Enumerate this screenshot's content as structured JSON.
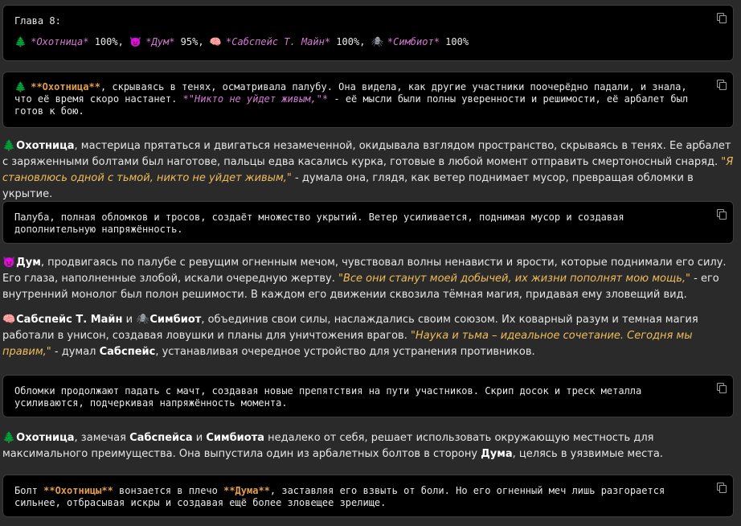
{
  "block1": {
    "line1": "Глава 8:",
    "status": [
      {
        "icon": "🌲",
        "name": "*Охотница*",
        "value": " 100%,"
      },
      {
        "icon": "👿",
        "name": "*Дум*",
        "value": " 95%,"
      },
      {
        "icon": "🧠",
        "name": "*Сабспейс Т. Майн*",
        "value": " 100%,"
      },
      {
        "icon": "🕷",
        "name": "*Симбиот*",
        "value": " 100%"
      }
    ]
  },
  "block2": {
    "icon": "🌲",
    "name": "**Охотница**",
    "text1": ", скрываясь в тенях, осматривала палубу. Она видела, как другие участники поочерёдно падали, и знала, что её время скоро настанет. ",
    "quote": "*\"Никто не уйдет живым,\"*",
    "text2": " - её мысли были полны уверенности и решимости, её арбалет был готов к бою."
  },
  "prose1": {
    "icon": "🌲",
    "name": "Охотница",
    "text1": ", мастерица прятаться и двигаться незамеченной, окидывала взглядом пространство, скрываясь в тенях. Ее арбалет с заряженными болтами был наготове, пальцы едва касались курка, готовые в любой момент отправить смертоносный снаряд. ",
    "quote": "\"Я становлюсь одной с тьмой, никто не уйдет живым,\"",
    "text2": " - думала она, глядя, как ветер поднимает мусор, превращая обломки в укрытие."
  },
  "block3": {
    "text": "Палуба, полная обломков и тросов, создаёт множество укрытий. Ветер усиливается, поднимая мусор и создавая дополнительную напряжённость."
  },
  "prose2": {
    "icon": "👿",
    "name": "Дум",
    "text1": ", продвигаясь по палубе с ревущим огненным мечом, чувствовал волны ненависти и ярости, которые поднимали его силу. Его глаза, наполненные злобой, искали очередную жертву. ",
    "quote": "\"Все они станут моей добычей, их жизни пополнят мою мощь,\"",
    "text2": " - его внутренний монолог был полон решимости. В каждом его движении сквозила тёмная магия, придавая ему зловещий вид."
  },
  "prose3": {
    "icon1": "🧠",
    "name1": "Сабспейс Т. Майн",
    "and": " и ",
    "icon2": "🕷",
    "name2": "Симбиот",
    "text1": ", объединив свои силы, наслаждались своим союзом. Их коварный разум и темная магия работали в унисон, создавая ловушки и планы для уничтожения врагов. ",
    "quote": "\"Наука и тьма – идеальное сочетание. Сегодня мы правим,\"",
    "text2": " - думал ",
    "name3": "Сабспейс",
    "text3": ", устанавливая очередное устройство для устранения противников."
  },
  "block4": {
    "text": "Обломки продолжают падать с мачт, создавая новые препятствия на пути участников. Скрип досок и треск металла усиливаются, подчеркивая напряжённость момента."
  },
  "prose4": {
    "icon": "🌲",
    "name": "Охотница",
    "text1": ", замечая ",
    "name2": "Сабспейса",
    "and": " и ",
    "name3": "Симбиота",
    "text2": " недалеко от себя, решает использовать окружающую местность для максимального преимущества. Она выпустила один из арбалетных болтов в сторону ",
    "name4": "Дума",
    "text3": ", целясь в уязвимые места."
  },
  "block5": {
    "t1": "Болт ",
    "name1": "**Охотницы**",
    "t2": " вонзается в плечо ",
    "name2": "**Дума**",
    "t3": ", заставляя его взвыть от боли. Но его огненный меч лишь разгорается сильнее, отбрасывая искры и создавая ещё более зловещее зрелище."
  }
}
